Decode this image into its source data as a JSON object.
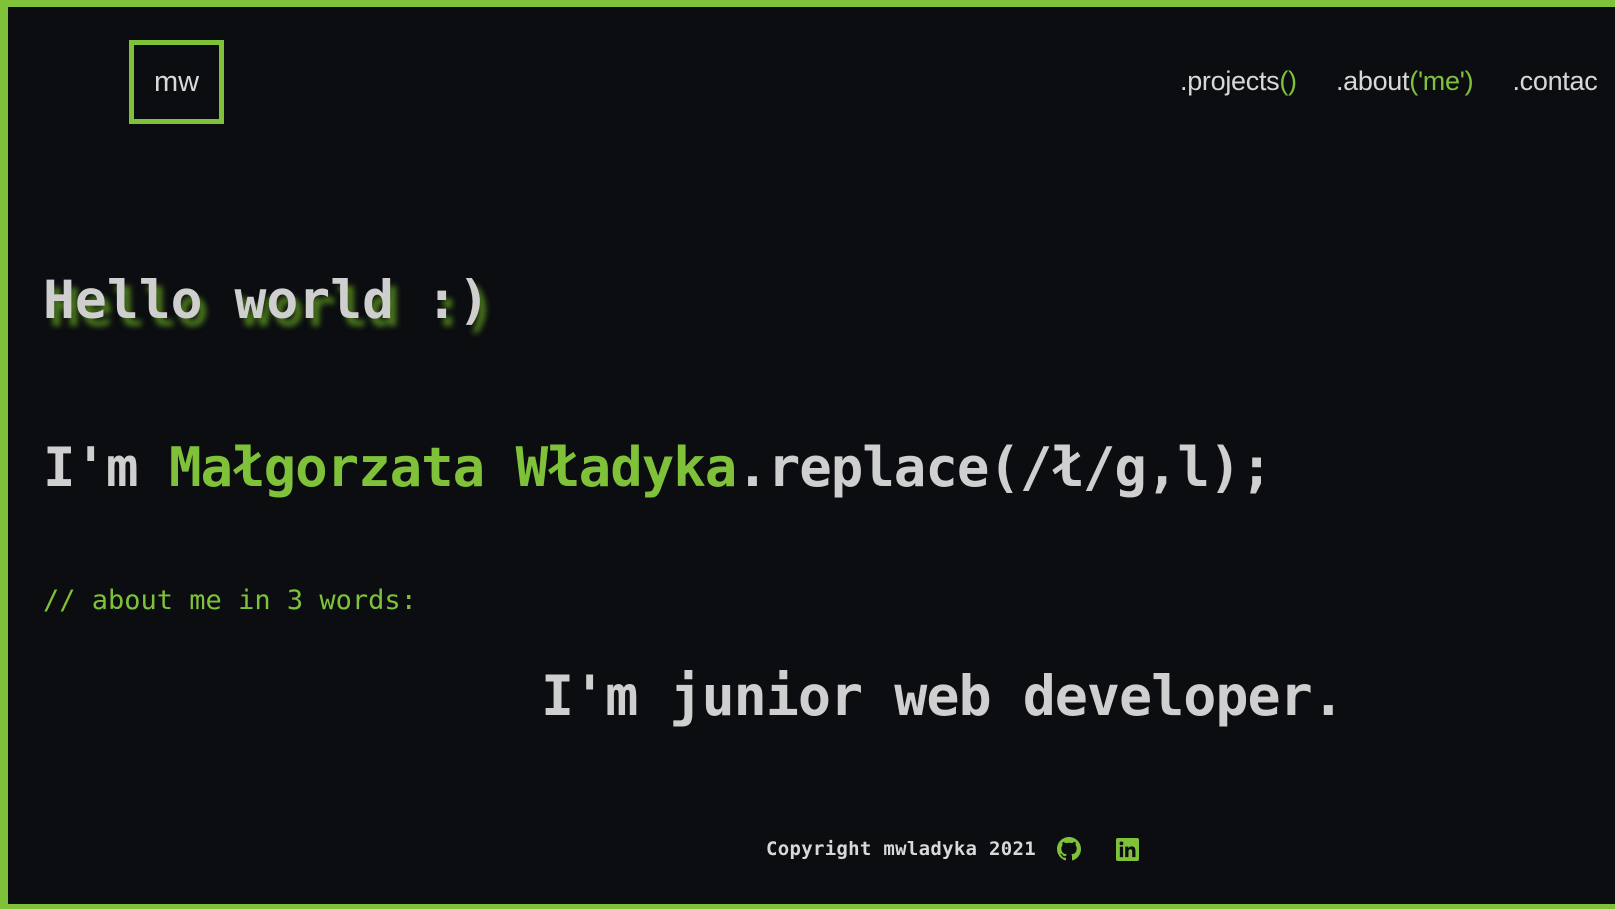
{
  "header": {
    "logo_text": "mw",
    "nav": [
      {
        "name": ".projects",
        "paren_open": "(",
        "arg": "",
        "paren_close": ")"
      },
      {
        "name": ".about",
        "paren_open": "(",
        "arg": "'me'",
        "paren_close": ")"
      },
      {
        "name": ".contac",
        "paren_open": "",
        "arg": "",
        "paren_close": ""
      }
    ]
  },
  "hero": {
    "greeting": "Hello world :)",
    "intro_prefix": "I'm ",
    "intro_name": "Małgorzata Władyka",
    "intro_suffix": ".replace(/ł/g,l);",
    "comment": "// about me in 3 words:",
    "typed_text": "I'm junior web developer."
  },
  "footer": {
    "copyright": "Copyright mwladyka 2021",
    "social": [
      {
        "icon": "github-icon"
      },
      {
        "icon": "linkedin-icon"
      }
    ]
  },
  "colors": {
    "background": "#0b0d10",
    "accent": "#7fc23a",
    "text": "#cfcfcf",
    "glow": "#4c7a1d"
  }
}
